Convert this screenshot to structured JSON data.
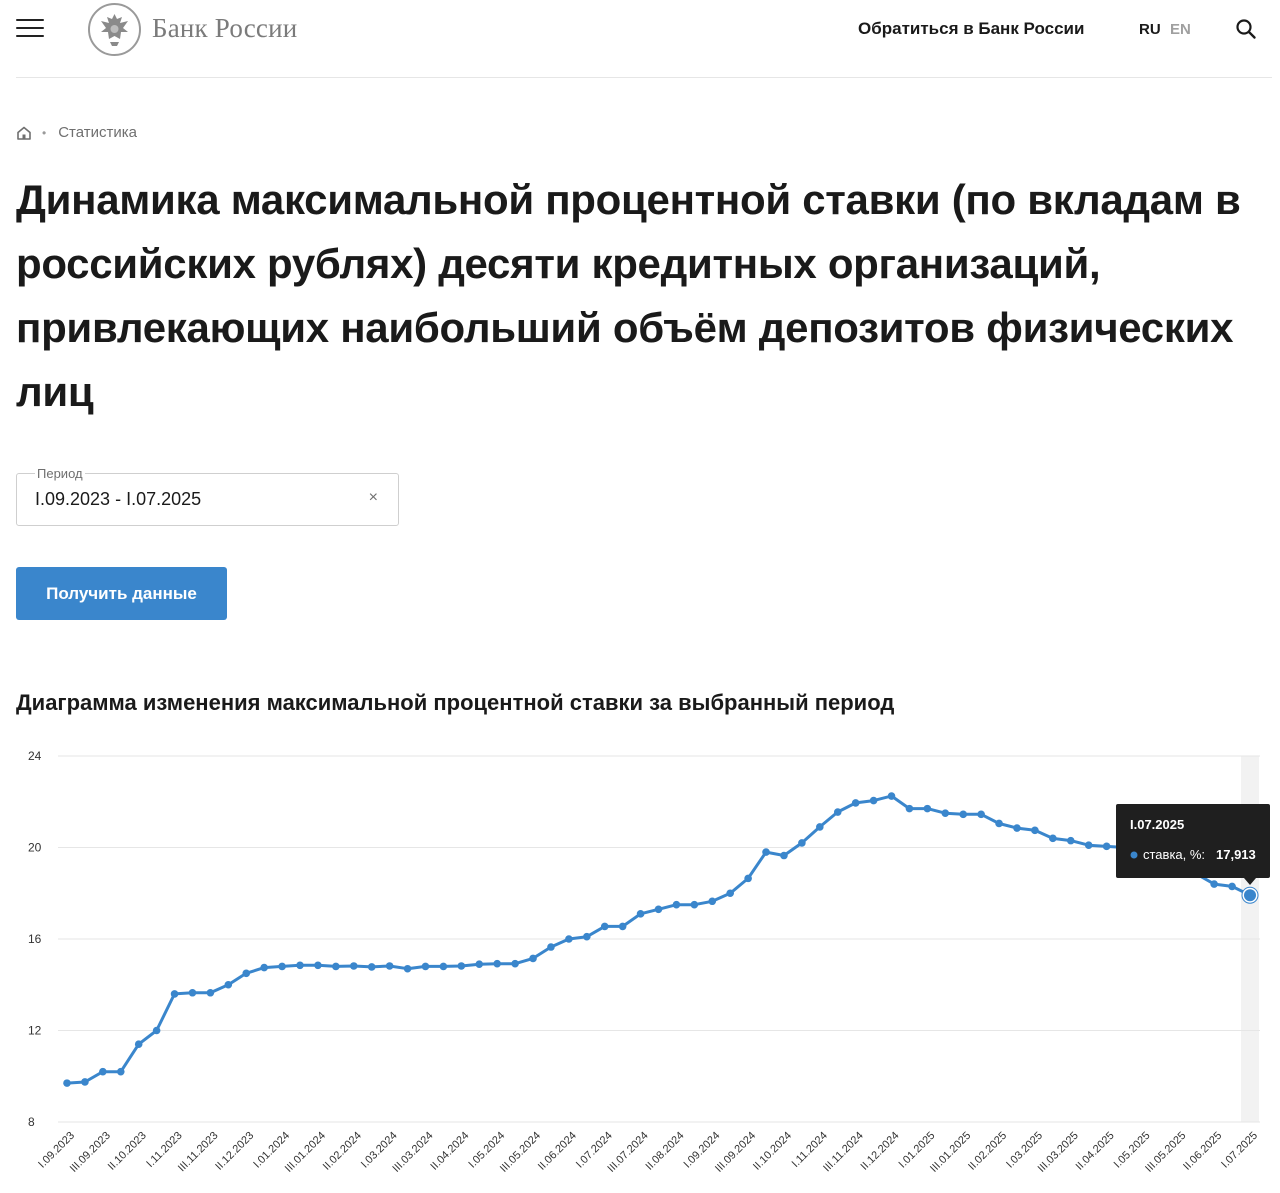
{
  "header": {
    "logo_text": "Банк России",
    "contact_link": "Обратиться в Банк России",
    "lang_ru": "RU",
    "lang_en": "EN",
    "icons": {
      "menu": "menu-icon",
      "logo": "bank-emblem",
      "search": "search-icon"
    }
  },
  "breadcrumb": {
    "home_icon": "home-icon",
    "item": "Статистика"
  },
  "page_title": "Динамика максимальной процентной ставки (по вкладам в российских рублях) десяти кредитных организаций, привлекающих наибольший объём депозитов физических лиц",
  "filter": {
    "label": "Период",
    "value": "I.09.2023 - I.07.2025",
    "clear_icon": "×"
  },
  "get_button": "Получить данные",
  "chart_title": "Диаграмма изменения максимальной процентной ставки за выбранный период",
  "colors": {
    "accent": "#3a86cc",
    "line": "#3a86cc",
    "grid": "#e6e6e6",
    "tooltip_bg": "#1f1f1f"
  },
  "chart_data": {
    "type": "line",
    "ylim": [
      8,
      24
    ],
    "yticks": [
      8,
      12,
      16,
      20,
      24
    ],
    "grid": true,
    "tick_labels": [
      "I.09.2023",
      "III.09.2023",
      "II.10.2023",
      "I.11.2023",
      "III.11.2023",
      "II.12.2023",
      "I.01.2024",
      "III.01.2024",
      "II.02.2024",
      "I.03.2024",
      "III.03.2024",
      "II.04.2024",
      "I.05.2024",
      "III.05.2024",
      "II.06.2024",
      "I.07.2024",
      "III.07.2024",
      "II.08.2024",
      "I.09.2024",
      "III.09.2024",
      "II.10.2024",
      "I.11.2024",
      "III.11.2024",
      "II.12.2024",
      "I.01.2025",
      "III.01.2025",
      "II.02.2025",
      "I.03.2025",
      "III.03.2025",
      "II.04.2025",
      "I.05.2025",
      "III.05.2025",
      "II.06.2025",
      "I.07.2025"
    ],
    "values": [
      9.7,
      9.75,
      10.2,
      10.2,
      11.4,
      12.0,
      13.6,
      13.65,
      13.65,
      14.0,
      14.5,
      14.75,
      14.8,
      14.85,
      14.85,
      14.8,
      14.82,
      14.78,
      14.82,
      14.7,
      14.8,
      14.8,
      14.82,
      14.9,
      14.92,
      14.92,
      15.15,
      15.65,
      16.0,
      16.1,
      16.55,
      16.55,
      17.1,
      17.3,
      17.5,
      17.5,
      17.65,
      18.0,
      18.65,
      19.8,
      19.65,
      20.2,
      20.9,
      21.55,
      21.95,
      22.05,
      22.25,
      21.7,
      21.7,
      21.5,
      21.45,
      21.45,
      21.05,
      20.85,
      20.75,
      20.4,
      20.3,
      20.1,
      20.05,
      20.0,
      19.7,
      19.45,
      19.1,
      18.85,
      18.4,
      18.3,
      17.913
    ],
    "series": [
      {
        "name": "ставка, %"
      }
    ],
    "tooltip": {
      "date": "I.07.2025",
      "series_label": "ставка, %:",
      "value": "17,913"
    }
  }
}
